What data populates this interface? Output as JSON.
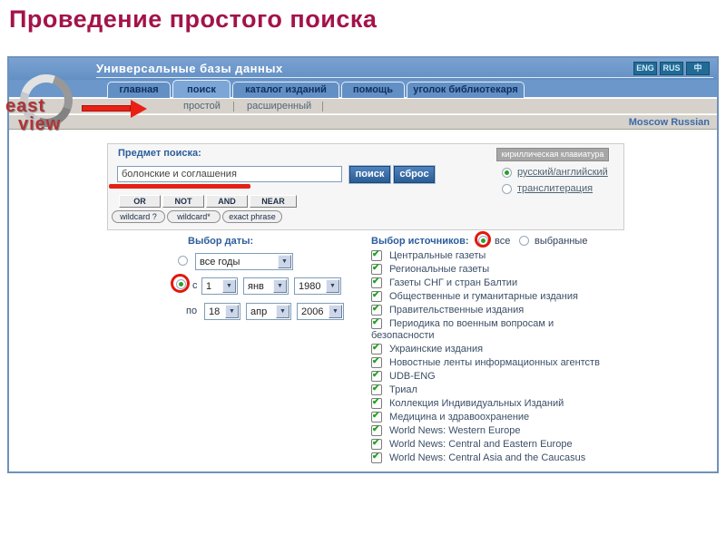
{
  "slide": {
    "title": "Проведение простого поиска"
  },
  "window": {
    "header": {
      "title": "Универсальные базы данных",
      "lang_buttons": [
        "ENG",
        "RUS",
        "中"
      ]
    },
    "logo": {
      "line1": "east",
      "line2": "view"
    },
    "tabs": [
      "главная",
      "поиск",
      "каталог изданий",
      "помощь",
      "уголок библиотекаря"
    ],
    "subnav": [
      "простой",
      "расширенный"
    ],
    "locale": "Moscow Russian",
    "search": {
      "label": "Предмет поиска:",
      "query": "болонские и соглашения",
      "search_button": "поиск",
      "reset_button": "сброс",
      "keyboard_button": "кириллическая клавиатура",
      "lang_option_1": "русский/английский",
      "lang_option_2": "транслитерация",
      "operators": [
        "OR",
        "NOT",
        "AND",
        "NEAR"
      ],
      "modifiers": [
        "wildcard ?",
        "wildcard*",
        "exact phrase"
      ]
    },
    "date": {
      "label": "Выбор даты:",
      "all_years": "все годы",
      "from_label": "с",
      "from_day": "1",
      "from_month": "янв",
      "from_year": "1980",
      "to_label": "по",
      "to_day": "18",
      "to_month": "апр",
      "to_year": "2006"
    },
    "sources": {
      "label": "Выбор источников:",
      "all_label": "все",
      "selected_label": "выбранные",
      "items": [
        "Центральные газеты",
        "Региональные газеты",
        "Газеты СНГ и стран Балтии",
        "Общественные и гуманитарные издания",
        "Правительственные издания",
        "Периодика по военным вопросам и безопасности",
        "Украинские издания",
        "Новостные ленты информационных агентств",
        "UDB-ENG",
        "Триал",
        "Коллекция Индивидуальных Изданий",
        "Медицина и здравоохранение",
        "World News: Western Europe",
        "World News: Central and Eastern Europe",
        "World News: Central Asia and the Caucasus"
      ]
    }
  }
}
